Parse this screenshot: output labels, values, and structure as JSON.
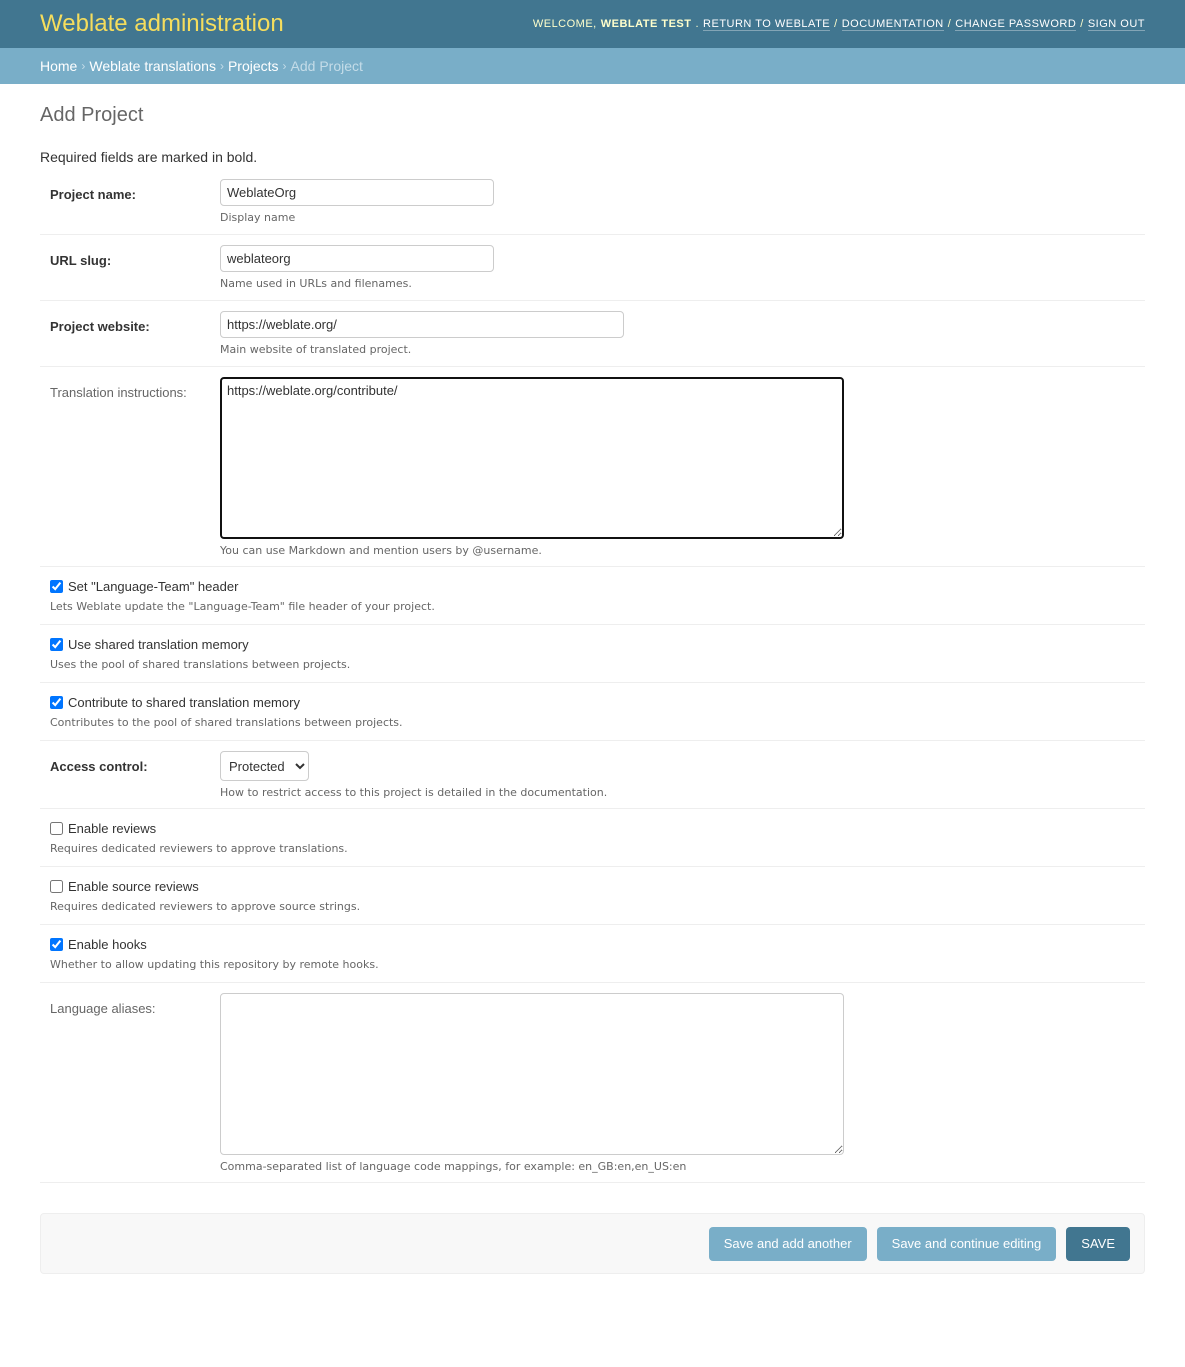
{
  "header": {
    "branding": "Weblate administration",
    "welcome": "Welcome,",
    "user": "Weblate Test",
    "links": [
      "Return to Weblate",
      "Documentation",
      "Change password",
      "Sign out"
    ]
  },
  "breadcrumbs": {
    "items": [
      "Home",
      "Weblate translations",
      "Projects"
    ],
    "current": "Add Project",
    "separator": "›"
  },
  "page": {
    "title": "Add Project",
    "required_note": "Required fields are marked in bold."
  },
  "fields": {
    "name": {
      "label": "Project name:",
      "value": "WeblateOrg",
      "help": "Display name"
    },
    "slug": {
      "label": "URL slug:",
      "value": "weblateorg",
      "help": "Name used in URLs and filenames."
    },
    "web": {
      "label": "Project website:",
      "value": "https://weblate.org/",
      "help": "Main website of translated project."
    },
    "instructions": {
      "label": "Translation instructions:",
      "value": "https://weblate.org/contribute/",
      "help": "You can use Markdown and mention users by @username."
    },
    "language_team": {
      "label": "Set \"Language-Team\" header",
      "checked": true,
      "help": "Lets Weblate update the \"Language-Team\" file header of your project."
    },
    "use_shared_tm": {
      "label": "Use shared translation memory",
      "checked": true,
      "help": "Uses the pool of shared translations between projects."
    },
    "contribute_shared_tm": {
      "label": "Contribute to shared translation memory",
      "checked": true,
      "help": "Contributes to the pool of shared translations between projects."
    },
    "access_control": {
      "label": "Access control:",
      "value": "Protected",
      "help": "How to restrict access to this project is detailed in the documentation."
    },
    "enable_review": {
      "label": "Enable reviews",
      "checked": false,
      "help": "Requires dedicated reviewers to approve translations."
    },
    "source_review": {
      "label": "Enable source reviews",
      "checked": false,
      "help": "Requires dedicated reviewers to approve source strings."
    },
    "enable_hooks": {
      "label": "Enable hooks",
      "checked": true,
      "help": "Whether to allow updating this repository by remote hooks."
    },
    "language_aliases": {
      "label": "Language aliases:",
      "value": "",
      "help": "Comma-separated list of language code mappings, for example: en_GB:en,en_US:en"
    }
  },
  "actions": {
    "save_add": "Save and add another",
    "save_continue": "Save and continue editing",
    "save": "Save"
  },
  "colors": {
    "header_bg": "#417690",
    "branding": "#f5dd5d",
    "breadcrumbs_bg": "#79aec8",
    "default_button": "#417690",
    "secondary_button": "#79aec8"
  }
}
